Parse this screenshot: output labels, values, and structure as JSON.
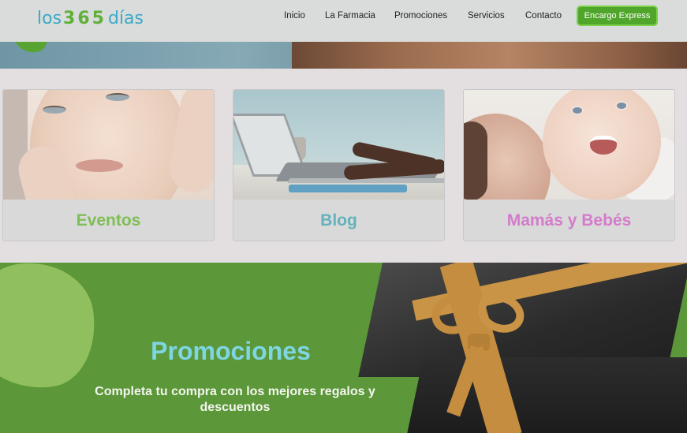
{
  "header": {
    "logo": {
      "pre": "los",
      "num": "365",
      "post": "días"
    },
    "nav": [
      {
        "label": "Inicio"
      },
      {
        "label": "La Farmacia"
      },
      {
        "label": "Promociones"
      },
      {
        "label": "Servicios"
      },
      {
        "label": "Contacto"
      }
    ],
    "cta_label": "Encargo Express"
  },
  "cards": [
    {
      "title": "Eventos",
      "color": "#7fbe56"
    },
    {
      "title": "Blog",
      "color": "#63b2bd"
    },
    {
      "title": "Mamás y Bebés",
      "color": "#d47bcb"
    }
  ],
  "promo": {
    "title": "Promociones",
    "subtitle": "Completa tu compra con los mejores regalos y descuentos"
  },
  "colors": {
    "brand_green": "#4fa62a",
    "brand_blue": "#3aa9c8",
    "promo_bg": "#5c9739"
  }
}
